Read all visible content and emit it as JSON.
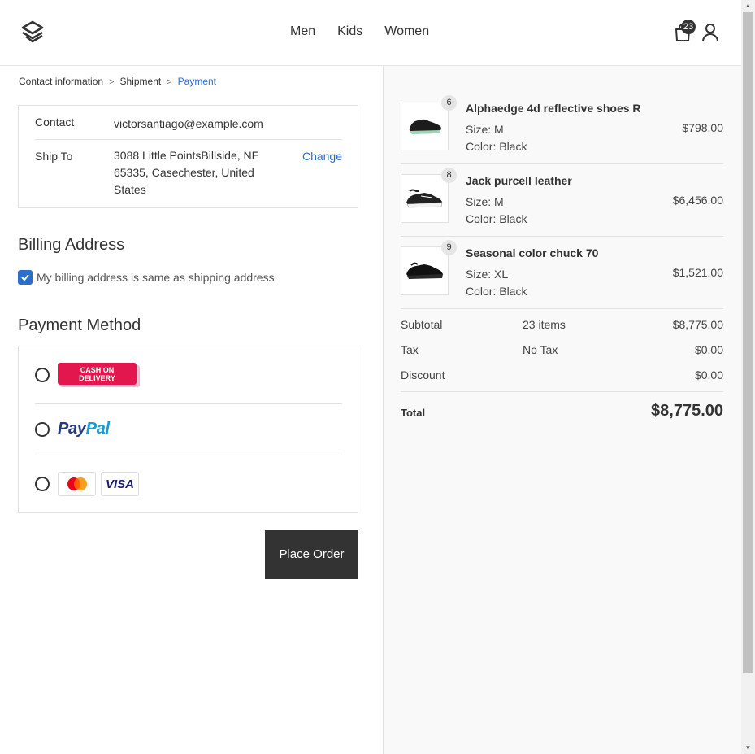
{
  "header": {
    "nav": [
      "Men",
      "Kids",
      "Women"
    ],
    "cart_count": "23"
  },
  "breadcrumb": {
    "step1": "Contact information",
    "step2": "Shipment",
    "step3": "Payment"
  },
  "contact": {
    "contact_label": "Contact",
    "contact_value": "victorsantiago@example.com",
    "ship_label": "Ship To",
    "ship_line1": "3088 Little PointsBillside, NE",
    "ship_line2": "65335, Casechester, United",
    "ship_line3": "States",
    "change_label": "Change"
  },
  "billing": {
    "title": "Billing Address",
    "same_as_shipping": "My billing address is same as shipping address",
    "checked": true
  },
  "payment": {
    "title": "Payment Method",
    "cod_line1": "CASH ON",
    "cod_line2": "DELIVERY",
    "paypal_pay": "Pay",
    "paypal_pal": "Pal",
    "visa": "VISA",
    "place_order": "Place Order"
  },
  "cart": {
    "items": [
      {
        "name": "Alphaedge 4d reflective shoes R",
        "qty": "6",
        "size": "Size: M",
        "color": "Color: Black",
        "price": "$798.00"
      },
      {
        "name": "Jack purcell leather",
        "qty": "8",
        "size": "Size: M",
        "color": "Color: Black",
        "price": "$6,456.00"
      },
      {
        "name": "Seasonal color chuck 70",
        "qty": "9",
        "size": "Size: XL",
        "color": "Color: Black",
        "price": "$1,521.00"
      }
    ],
    "summary": {
      "subtotal_label": "Subtotal",
      "subtotal_items": "23 items",
      "subtotal_value": "$8,775.00",
      "tax_label": "Tax",
      "tax_note": "No Tax",
      "tax_value": "$0.00",
      "discount_label": "Discount",
      "discount_value": "$0.00",
      "total_label": "Total",
      "total_value": "$8,775.00"
    }
  },
  "colors": {
    "accent": "#2c6ecb",
    "button": "#333333",
    "cod": "#e2174d"
  }
}
